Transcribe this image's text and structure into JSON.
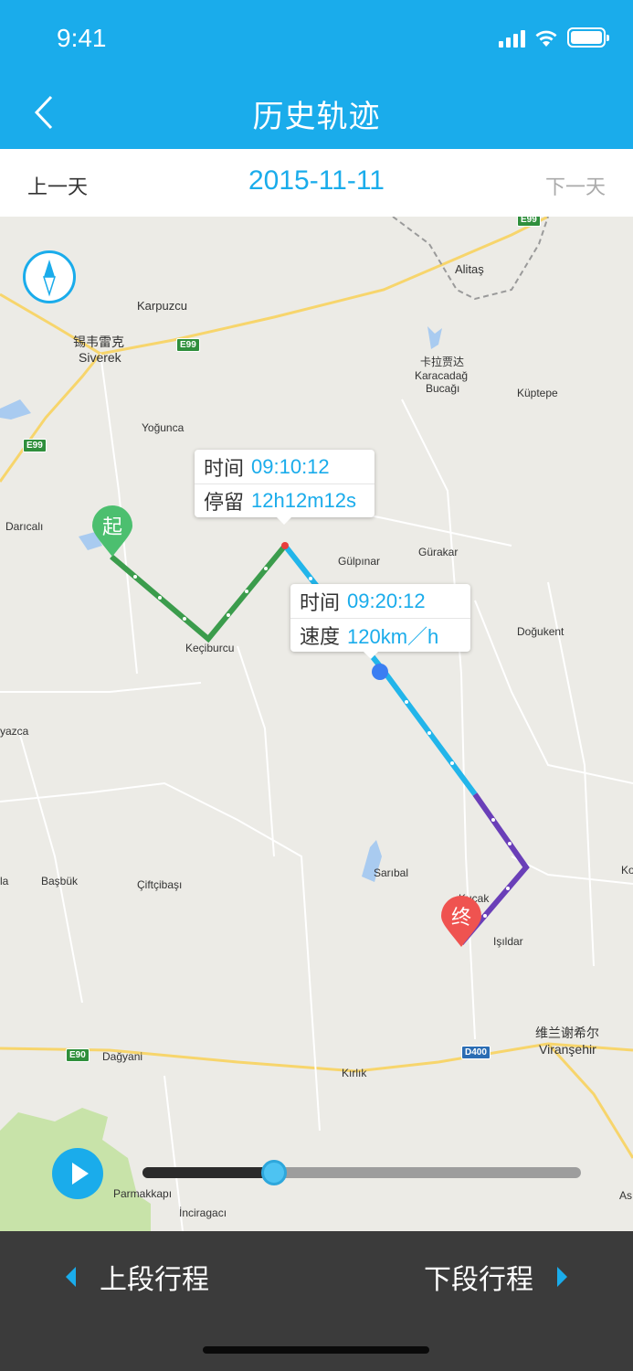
{
  "status_bar": {
    "time": "9:41"
  },
  "nav": {
    "title": "历史轨迹"
  },
  "date_bar": {
    "prev_label": "上一天",
    "date": "2015-11-11",
    "next_label": "下一天"
  },
  "map": {
    "places": {
      "alitas": "Alitaş",
      "karpuzcu": "Karpuzcu",
      "siverek_cn": "锡韦雷克",
      "siverek": "Siverek",
      "karacadag_cn": "卡拉贾达",
      "karacadag": "Karacadağ",
      "bucagi": "Bucağı",
      "kuptepe": "Küptepe",
      "yoguncа": "Yoğunca",
      "daricali": "Darıcalı",
      "gulpinar": "Gülpınar",
      "gurakar": "Gürakar",
      "kecıburcu": "Keçiburcu",
      "dogukent": "Doğukent",
      "yazca": "yazca",
      "la": "la",
      "basbuk": "Başbük",
      "ciftcibasi": "Çiftçibaşı",
      "saribal": "Sarıbal",
      "kucak": "Kucak",
      "isildar": "Işıldar",
      "ko": "Ko",
      "viransehir_cn": "维兰谢希尔",
      "viransehir": "Viranşehir",
      "dagyani": "Dağyani",
      "kirlik": "Kırlık",
      "parmakkapi": "Parmakkapı",
      "inciragaci": "İnciragacı",
      "as": "As"
    },
    "road_badges": {
      "e99_top": "E99",
      "e99_mid": "E99",
      "e99_left": "E99",
      "e90": "E90",
      "d400": "D400"
    },
    "start_pin": {
      "label": "起",
      "color": "#4cbf6f"
    },
    "end_pin": {
      "label": "终",
      "color": "#ef5350"
    },
    "callout_stop": {
      "time_label": "时间",
      "time_value": "09:10:12",
      "stay_label": "停留",
      "stay_value": "12h12m12s"
    },
    "callout_move": {
      "time_label": "时间",
      "time_value": "09:20:12",
      "speed_label": "速度",
      "speed_value": "120km／h"
    },
    "route_colors": {
      "slow": "#3b9c4c",
      "normal": "#22b5ea",
      "fast": "#6a3fb8"
    }
  },
  "playback": {
    "progress": 0.3,
    "icon": "play-icon"
  },
  "bottom_bar": {
    "prev_trip": "上段行程",
    "next_trip": "下段行程"
  },
  "colors": {
    "accent": "#1aaceb",
    "bottom_bg": "#3b3b3b"
  }
}
